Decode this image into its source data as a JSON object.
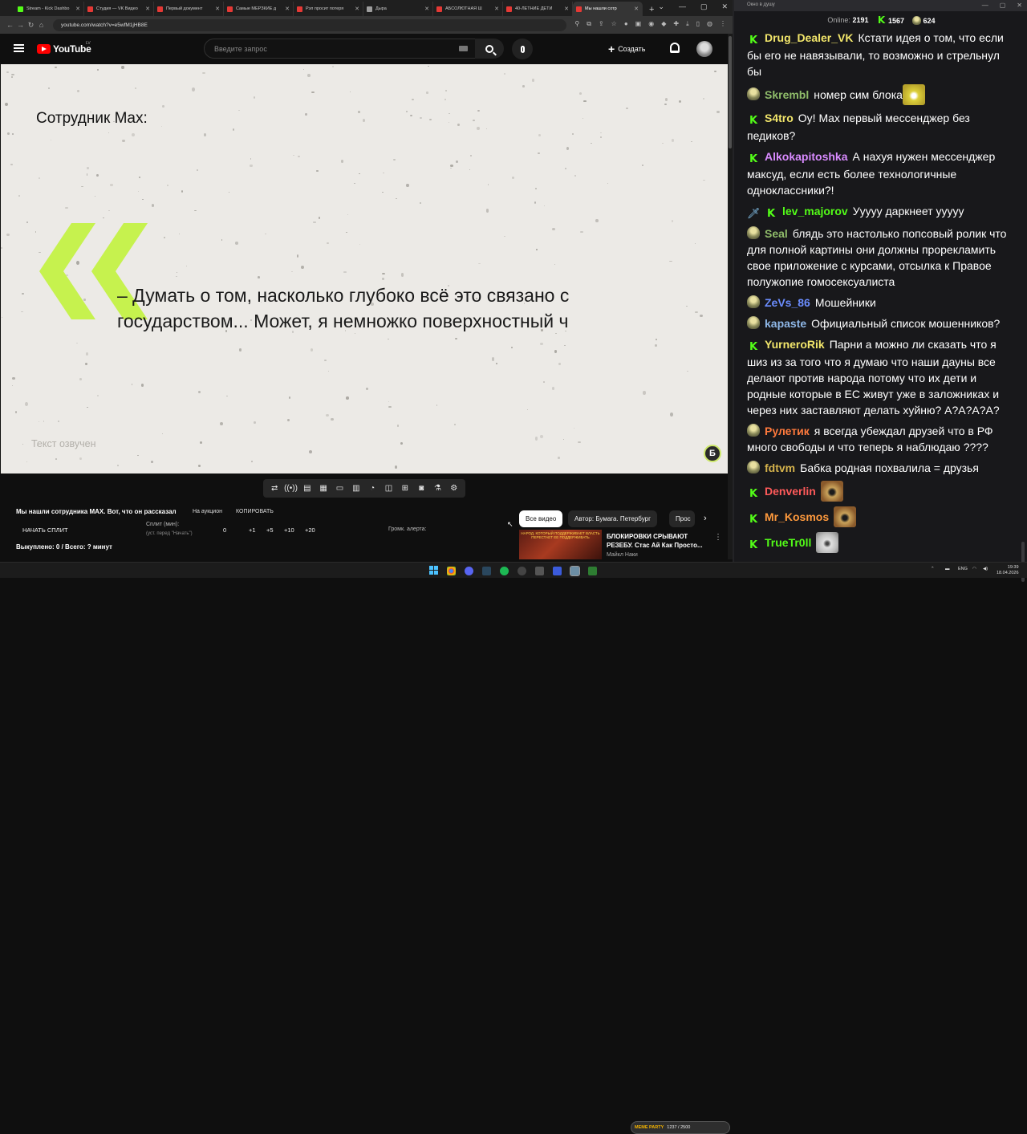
{
  "browser": {
    "tabs": [
      {
        "title": "Stream - Kick Dashbo",
        "color": "#53fc18"
      },
      {
        "title": "Студия — VK Видео",
        "color": "#e53935"
      },
      {
        "title": "Первый документ",
        "color": "#e53935"
      },
      {
        "title": "Самые МЕРЗКИЕ д",
        "color": "#e53935"
      },
      {
        "title": "Рэп просит потеря",
        "color": "#e53935"
      },
      {
        "title": "Дыра",
        "color": "#9e9e9e"
      },
      {
        "title": "АБСОЛЮТНАЯ Ш",
        "color": "#e53935"
      },
      {
        "title": "40-ЛЕТНИЕ ДЕТИ",
        "color": "#e53935"
      },
      {
        "title": "Мы нашли сотр",
        "color": "#e53935"
      }
    ],
    "url": "youtube.com/watch?v=e5wfM1jHB8E"
  },
  "youtube": {
    "logo": "YouTube",
    "country": "LV",
    "search_placeholder": "Введите запрос",
    "create_label": "Создать"
  },
  "video": {
    "speaker": "Сотрудник Max:",
    "quote": "– Думать о том, насколько глубоко всё это связано с государством... Может, я немножко поверхностный ч",
    "voiced": "Текст озвучен",
    "logo_letter": "Б",
    "accent_color": "#c6f24e"
  },
  "controls": {
    "icons": [
      "loop-icon",
      "broadcast-icon",
      "settings-video-icon",
      "clapper-icon",
      "miniplayer-icon",
      "theater-icon",
      "speed-icon",
      "filter-icon",
      "add-clip-icon",
      "camera-icon",
      "flask-icon",
      "gear-icon"
    ]
  },
  "below": {
    "title": "Мы нашли сотрудника MAX. Вот, что он рассказал",
    "auction": "На аукцион",
    "copy": "КОПИРОВАТЬ",
    "split_button": "НАЧАТЬ СПЛИТ",
    "split_label": "Сплит (мин):",
    "split_sub": "(уст. перед \"Начать\")",
    "split_value": "0",
    "increments": [
      "+1",
      "+5",
      "+10",
      "+20"
    ],
    "volume_label": "Громк. алерта:",
    "bought": "Выкуплено: 0 / Всего: ? минут"
  },
  "chips": [
    {
      "label": "Все видео",
      "active": true
    },
    {
      "label": "Автор: Бумага. Петербург",
      "active": false
    },
    {
      "label": "Прос",
      "active": false
    }
  ],
  "recommendation": {
    "thumb_text": "НАРОД, КОТОРЫЙ ПОДДЕРЖИВАЕТ ВЛАСТЬ ПЕРЕСТАЕТ ЕЕ ПОДДЕРЖИВАТЬ",
    "title": "БЛОКИРОВКИ СРЫВАЮТ РЕЗЕБУ. Стас Ай Как Просто...",
    "channel": "Майкл Наки"
  },
  "chat": {
    "window_title": "Окно в душу",
    "online_label": "Online:",
    "online": "2191",
    "stat1": "1567",
    "stat2": "624",
    "messages": [
      {
        "badge": "k",
        "name": "Drug_Dealer_VK",
        "color": "#f2e66b",
        "text": "Кстати идея о том, что если бы его не навязывали, то возможно и стрельнул бы"
      },
      {
        "badge": "av",
        "name": "Skrembl",
        "color": "#8fbc6a",
        "text": "номер сим блока",
        "emote": "smile"
      },
      {
        "badge": "k",
        "name": "S4tro",
        "color": "#f2e66b",
        "text": "Оу! Max первый мессенджер без педиков?"
      },
      {
        "badge": "k",
        "name": "Alkokapitoshka",
        "color": "#d98bff",
        "text": "А нахуя нужен мессенджер максуд, если есть более технологичные одноклассники?!"
      },
      {
        "badge": "sk",
        "name": "lev_majorov",
        "color": "#53fc18",
        "text": "Ууууу даркнеет ууууу"
      },
      {
        "badge": "av",
        "name": "Seal",
        "color": "#8fbc6a",
        "text": "блядь это настолько попсовый ролик что для полной картины они должны прорекламить свое приложение с курсами, отсылка к Правое полужопие гомосексуалиста"
      },
      {
        "badge": "av",
        "name": "ZeVs_86",
        "color": "#6b8dff",
        "text": "Мошейники"
      },
      {
        "badge": "av",
        "name": "kapaste",
        "color": "#8fb8e8",
        "text": "Официальный список мошенников?"
      },
      {
        "badge": "k",
        "name": "YurneroRik",
        "color": "#f2e66b",
        "text": "Парни а можно ли сказать что я шиз из за того что я думаю что наши дауны все делают против народа потому что их дети и родные которые в ЕС живут уже в заложниках и через них заставляют делать хуйню? А?А?А?А?"
      },
      {
        "badge": "av",
        "name": "Рулетик",
        "color": "#ff7a3d",
        "text": "я всегда убеждал друзей что в РФ много свободы и что теперь я наблюдаю ????"
      },
      {
        "badge": "av",
        "name": "fdtvm",
        "color": "#d4b24c",
        "text": "Бабка родная похвалила = друзья"
      },
      {
        "badge": "k",
        "name": "Denverlin",
        "color": "#ff5a5a",
        "text": "",
        "emote": "face"
      },
      {
        "badge": "k",
        "name": "Mr_Kosmos",
        "color": "#ff9a3d",
        "text": "",
        "emote": "face"
      },
      {
        "badge": "k",
        "name": "TrueTr0ll",
        "color": "#53fc18",
        "text": "",
        "emote": "cat"
      }
    ]
  },
  "taskbar": {
    "meme_label": "MEME PARTY",
    "meme_value": "1237 / 2500",
    "lang": "ENG",
    "time": "19:39",
    "date": "18.04.2026"
  }
}
